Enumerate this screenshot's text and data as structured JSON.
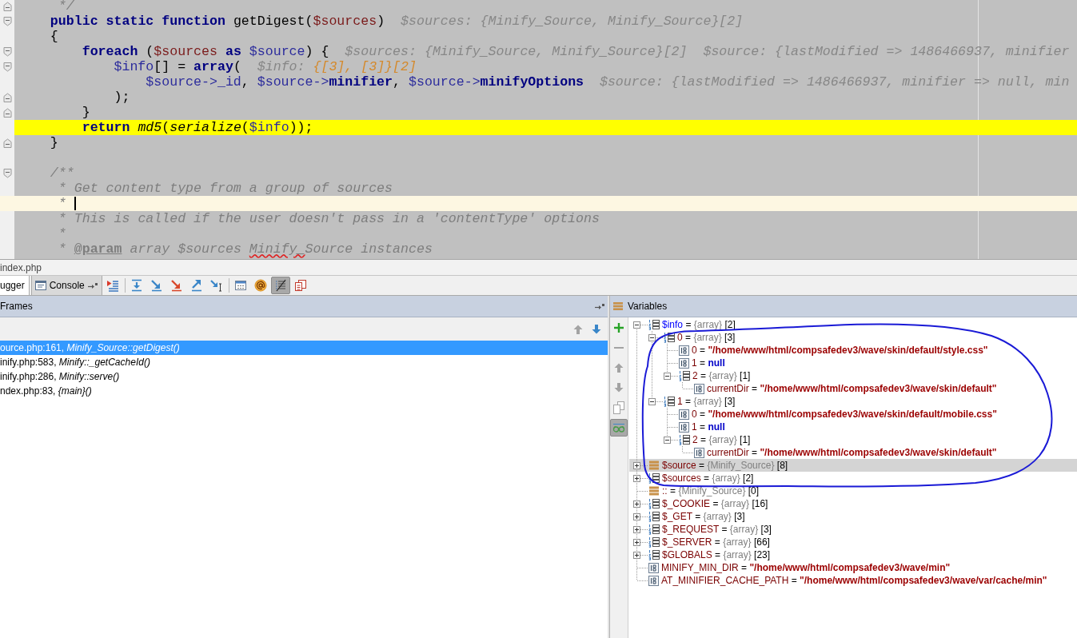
{
  "editor": {
    "lines": [
      {
        "fold_start": false,
        "fold_end": true,
        "execution_point": false,
        "caret": false,
        "tokens": [
          {
            "kind": "comment",
            "text": "     */"
          }
        ]
      },
      {
        "fold_start": true,
        "fold_end": false,
        "execution_point": false,
        "caret": false,
        "tokens": [
          {
            "kind": "keyword",
            "text": "    public static function"
          },
          {
            "kind": "plain",
            "text": " getDigest("
          },
          {
            "kind": "param",
            "text": "$sources"
          },
          {
            "kind": "plain",
            "text": ")"
          }
        ],
        "hints": [
          {
            "name": "$sources:",
            "value": "{Minify_Source, Minify_Source}[2]",
            "changed": false
          }
        ]
      },
      {
        "fold_start": false,
        "fold_end": false,
        "execution_point": false,
        "caret": false,
        "tokens": [
          {
            "kind": "plain",
            "text": "    {"
          }
        ]
      },
      {
        "fold_start": true,
        "fold_end": false,
        "execution_point": false,
        "caret": false,
        "tokens": [
          {
            "kind": "keyword",
            "text": "        foreach"
          },
          {
            "kind": "plain",
            "text": " ("
          },
          {
            "kind": "param",
            "text": "$sources"
          },
          {
            "kind": "keyword",
            "text": " as "
          },
          {
            "kind": "var",
            "text": "$source"
          },
          {
            "kind": "plain",
            "text": ") {"
          }
        ],
        "hints": [
          {
            "name": "$sources:",
            "value": "{Minify_Source, Minify_Source}[2]",
            "changed": false
          },
          {
            "name": "$source:",
            "value": "{lastModified => 1486466937, minifier",
            "changed": false
          }
        ]
      },
      {
        "fold_start": true,
        "fold_end": false,
        "execution_point": false,
        "caret": false,
        "tokens": [
          {
            "kind": "var",
            "text": "            $info"
          },
          {
            "kind": "plain",
            "text": "[] = "
          },
          {
            "kind": "keyword",
            "text": "array"
          },
          {
            "kind": "plain",
            "text": "("
          }
        ],
        "hints": [
          {
            "name": "$info:",
            "value": "{[3], [3]}[2]",
            "changed": true
          }
        ]
      },
      {
        "fold_start": false,
        "fold_end": false,
        "execution_point": false,
        "caret": false,
        "tokens": [
          {
            "kind": "var",
            "text": "                $source->_id"
          },
          {
            "kind": "plain",
            "text": ", "
          },
          {
            "kind": "var",
            "text": "$source->"
          },
          {
            "kind": "field",
            "text": "minifier"
          },
          {
            "kind": "plain",
            "text": ", "
          },
          {
            "kind": "var",
            "text": "$source->"
          },
          {
            "kind": "field",
            "text": "minifyOptions"
          }
        ],
        "hints": [
          {
            "name": "$source:",
            "value": "{lastModified => 1486466937, minifier => null, min",
            "changed": false
          }
        ]
      },
      {
        "fold_start": false,
        "fold_end": true,
        "execution_point": false,
        "caret": false,
        "tokens": [
          {
            "kind": "plain",
            "text": "            );"
          }
        ]
      },
      {
        "fold_start": false,
        "fold_end": true,
        "execution_point": false,
        "caret": false,
        "tokens": [
          {
            "kind": "plain",
            "text": "        }"
          }
        ]
      },
      {
        "fold_start": false,
        "fold_end": false,
        "execution_point": true,
        "caret": false,
        "tokens": [
          {
            "kind": "keyword",
            "text": "        return "
          },
          {
            "kind": "call",
            "text": "md5"
          },
          {
            "kind": "plain",
            "text": "("
          },
          {
            "kind": "call",
            "text": "serialize"
          },
          {
            "kind": "plain",
            "text": "("
          },
          {
            "kind": "var",
            "text": "$info"
          },
          {
            "kind": "plain",
            "text": "));"
          }
        ]
      },
      {
        "fold_start": false,
        "fold_end": true,
        "execution_point": false,
        "caret": false,
        "tokens": [
          {
            "kind": "plain",
            "text": "    }"
          }
        ]
      },
      {
        "fold_start": false,
        "fold_end": false,
        "execution_point": false,
        "caret": false
      },
      {
        "fold_start": true,
        "fold_end": false,
        "execution_point": false,
        "caret": false,
        "tokens": [
          {
            "kind": "comment",
            "text": "    /**"
          }
        ]
      },
      {
        "fold_start": false,
        "fold_end": false,
        "execution_point": false,
        "caret": false,
        "tokens": [
          {
            "kind": "comment",
            "text": "     * Get content type from a group of sources"
          }
        ]
      },
      {
        "fold_start": false,
        "fold_end": false,
        "execution_point": false,
        "caret": true,
        "tokens": [
          {
            "kind": "comment",
            "text": "     *"
          }
        ]
      },
      {
        "fold_start": false,
        "fold_end": false,
        "execution_point": false,
        "caret": false,
        "tokens": [
          {
            "kind": "comment",
            "text": "     * This is called if the user doesn't pass in a 'contentType' options"
          }
        ]
      },
      {
        "fold_start": false,
        "fold_end": false,
        "execution_point": false,
        "caret": false,
        "tokens": [
          {
            "kind": "comment",
            "text": "     *"
          }
        ]
      },
      {
        "fold_start": false,
        "fold_end": false,
        "execution_point": false,
        "caret": false,
        "tokens": [
          {
            "kind": "comment",
            "text": "     * "
          },
          {
            "kind": "doc_tag",
            "text": "@param"
          },
          {
            "kind": "comment",
            "text": " array $sources "
          },
          {
            "kind": "typo",
            "text": "Minify_"
          },
          {
            "kind": "comment",
            "text": "Source instances"
          }
        ]
      }
    ]
  },
  "breadcrumb": {
    "label": "index.php"
  },
  "debug_tabs": [
    {
      "label": "ugger",
      "selected": true
    },
    {
      "label": "Console",
      "selected": false
    }
  ],
  "toolbar_buttons": [
    {
      "pressed": false
    },
    {
      "pressed": false
    },
    {
      "pressed": false
    },
    {
      "pressed": false
    },
    {
      "pressed": false
    },
    {
      "pressed": false
    },
    {
      "pressed": false
    },
    {
      "pressed": false
    },
    {
      "pressed": true
    },
    {
      "pressed": false
    }
  ],
  "frames": {
    "title": "Frames",
    "nav_buttons": [
      {
        "disabled": true
      },
      {
        "disabled": false
      }
    ],
    "items": [
      {
        "label": "ource.php:161, *Minify_Source::getDigest()*",
        "selected": true
      },
      {
        "label": "inify.php:583, *Minify::_getCacheId()*",
        "selected": false
      },
      {
        "label": "inify.php:286, *Minify::serve()*",
        "selected": false
      },
      {
        "label": "ndex.php:83, *{main}()*",
        "selected": false
      }
    ]
  },
  "variables": {
    "title": "Variables",
    "side_buttons": [
      {
        "disabled": false,
        "pressed": false
      },
      {
        "disabled": true,
        "pressed": false
      },
      {
        "disabled": true,
        "pressed": false
      },
      {
        "disabled": true,
        "pressed": false
      },
      {
        "disabled": true,
        "pressed": false
      },
      {
        "disabled": false,
        "pressed": true
      }
    ],
    "tree": [
      {
        "name": "$info",
        "sep": "=",
        "kind": "array",
        "type": "{array}",
        "count": "[2]",
        "changed": true,
        "selected": false,
        "expanded": true,
        "children": [
          {
            "name": "0",
            "sep": "=",
            "kind": "array",
            "type": "{array}",
            "count": "[3]",
            "changed": false,
            "selected": false,
            "expanded": true,
            "children": [
              {
                "name": "0",
                "sep": "=",
                "kind": "string",
                "value": "\"/home/www/html/compsafedev3/wave/skin/default/style.css\"",
                "changed": false,
                "selected": false
              },
              {
                "name": "1",
                "sep": "=",
                "kind": "null",
                "value": "null",
                "changed": false,
                "selected": false
              },
              {
                "name": "2",
                "sep": "=",
                "kind": "array",
                "type": "{array}",
                "count": "[1]",
                "changed": false,
                "selected": false,
                "expanded": true,
                "children": [
                  {
                    "name": "currentDir",
                    "sep": "=",
                    "kind": "string",
                    "value": "\"/home/www/html/compsafedev3/wave/skin/default\"",
                    "changed": false,
                    "selected": false
                  }
                ]
              }
            ]
          },
          {
            "name": "1",
            "sep": "=",
            "kind": "array",
            "type": "{array}",
            "count": "[3]",
            "changed": false,
            "selected": false,
            "expanded": true,
            "children": [
              {
                "name": "0",
                "sep": "=",
                "kind": "string",
                "value": "\"/home/www/html/compsafedev3/wave/skin/default/mobile.css\"",
                "changed": false,
                "selected": false
              },
              {
                "name": "1",
                "sep": "=",
                "kind": "null",
                "value": "null",
                "changed": false,
                "selected": false
              },
              {
                "name": "2",
                "sep": "=",
                "kind": "array",
                "type": "{array}",
                "count": "[1]",
                "changed": false,
                "selected": false,
                "expanded": true,
                "children": [
                  {
                    "name": "currentDir",
                    "sep": "=",
                    "kind": "string",
                    "value": "\"/home/www/html/compsafedev3/wave/skin/default\"",
                    "changed": false,
                    "selected": false
                  }
                ]
              }
            ]
          }
        ]
      },
      {
        "name": "$source",
        "sep": "=",
        "kind": "object",
        "type": "{Minify_Source}",
        "count": "[8]",
        "changed": false,
        "selected": true,
        "expanded": false
      },
      {
        "name": "$sources",
        "sep": "=",
        "kind": "array",
        "type": "{array}",
        "count": "[2]",
        "changed": false,
        "selected": false,
        "expanded": false
      },
      {
        "name": "::",
        "sep": "=",
        "kind": "object",
        "type": "{Minify_Source}",
        "count": "[0]",
        "changed": false,
        "selected": false
      },
      {
        "name": "$_COOKIE",
        "sep": "=",
        "kind": "array",
        "type": "{array}",
        "count": "[16]",
        "changed": false,
        "selected": false,
        "expanded": false
      },
      {
        "name": "$_GET",
        "sep": "=",
        "kind": "array",
        "type": "{array}",
        "count": "[3]",
        "changed": false,
        "selected": false,
        "expanded": false
      },
      {
        "name": "$_REQUEST",
        "sep": "=",
        "kind": "array",
        "type": "{array}",
        "count": "[3]",
        "changed": false,
        "selected": false,
        "expanded": false
      },
      {
        "name": "$_SERVER",
        "sep": "=",
        "kind": "array",
        "type": "{array}",
        "count": "[66]",
        "changed": false,
        "selected": false,
        "expanded": false
      },
      {
        "name": "$GLOBALS",
        "sep": "=",
        "kind": "array",
        "type": "{array}",
        "count": "[23]",
        "changed": false,
        "selected": false,
        "expanded": false
      },
      {
        "name": "MINIFY_MIN_DIR",
        "sep": "=",
        "kind": "string",
        "value": "\"/home/www/html/compsafedev3/wave/min\"",
        "changed": false,
        "selected": false
      },
      {
        "name": "AT_MINIFIER_CACHE_PATH",
        "sep": "=",
        "kind": "string",
        "value": "\"/home/www/html/compsafedev3/wave/var/cache/min\"",
        "changed": false,
        "selected": false
      }
    ]
  }
}
